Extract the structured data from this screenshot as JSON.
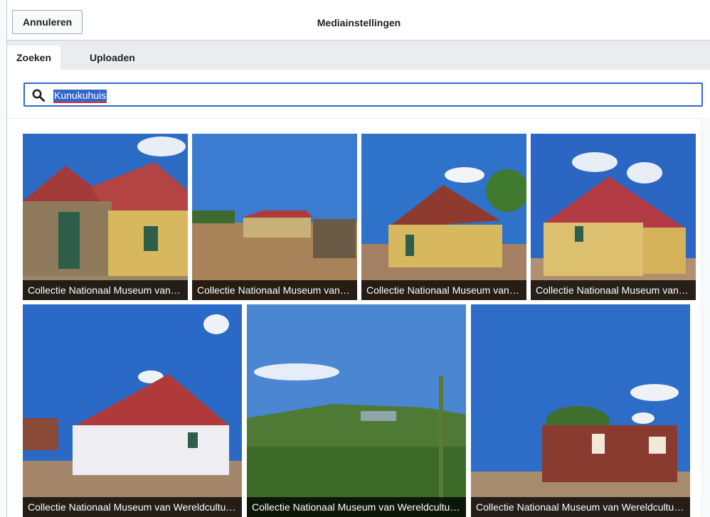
{
  "header": {
    "cancel_label": "Annuleren",
    "title": "Mediainstellingen"
  },
  "tabs": [
    {
      "label": "Zoeken",
      "active": true
    },
    {
      "label": "Uploaden",
      "active": false
    }
  ],
  "search": {
    "value": "Kunukuhuis",
    "icon": "search-icon"
  },
  "results": [
    {
      "caption": "Collectie Nationaal Museum van Wereldculturen"
    },
    {
      "caption": "Collectie Nationaal Museum van Wereldculturen"
    },
    {
      "caption": "Collectie Nationaal Museum van Wereldculturen"
    },
    {
      "caption": "Collectie Nationaal Museum van Wereldculturen"
    },
    {
      "caption": "Collectie Nationaal Museum van Wereldculturen"
    },
    {
      "caption": "Collectie Nationaal Museum van Wereldculturen"
    },
    {
      "caption": "Collectie Nationaal Museum van Wereldculturen"
    }
  ],
  "colors": {
    "accent": "#3366cc",
    "sky": "#2f6fc9",
    "roof": "#b03a3a",
    "wall": "#d9b75c",
    "ground": "#a8835a"
  }
}
